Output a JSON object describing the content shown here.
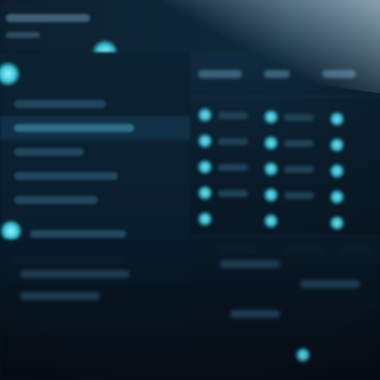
{
  "theme": {
    "accent": "#35c6d9",
    "background": "#071522",
    "panel": "#0b2233"
  },
  "icons": {
    "sidebar_status": "status-dot-icon",
    "table_status": "status-dot-icon"
  },
  "sidebar": {
    "active_item_index": 2,
    "item_count": 7
  },
  "table": {
    "column_count": 3,
    "row_count": 6
  }
}
